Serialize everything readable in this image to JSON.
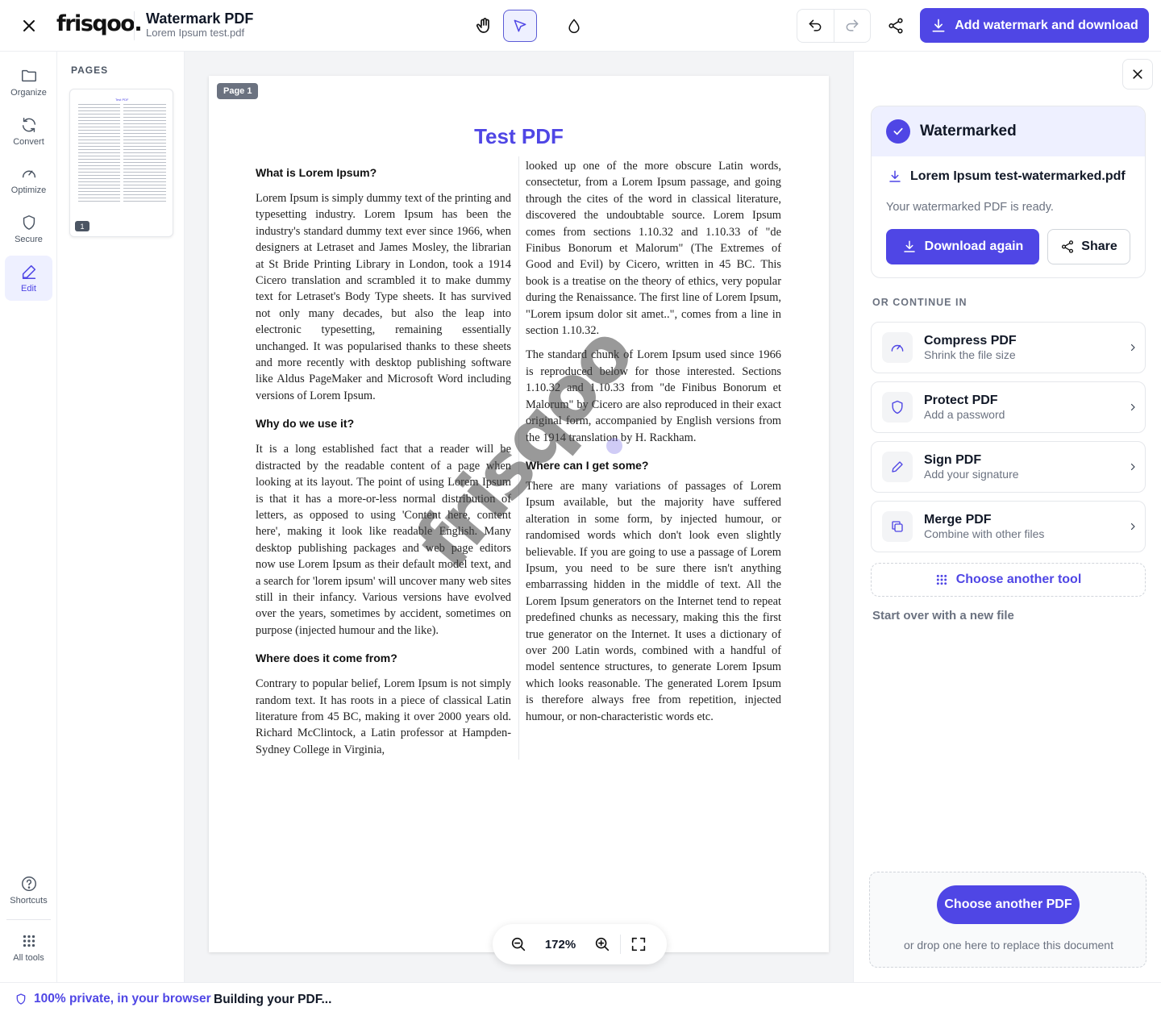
{
  "header": {
    "logo": "frisqoo.",
    "title": "Watermark PDF",
    "filename": "Lorem Ipsum test.pdf",
    "primary_label": "Add watermark and download"
  },
  "rail": {
    "items": [
      {
        "label": "Organize",
        "icon": "folder-icon"
      },
      {
        "label": "Convert",
        "icon": "refresh-icon"
      },
      {
        "label": "Optimize",
        "icon": "gauge-icon"
      },
      {
        "label": "Secure",
        "icon": "shield-icon"
      },
      {
        "label": "Edit",
        "icon": "pencil-icon",
        "active": true
      }
    ],
    "bottom": [
      {
        "label": "Shortcuts",
        "icon": "question-icon"
      },
      {
        "label": "All tools",
        "icon": "grid-icon"
      }
    ]
  },
  "pages_panel": {
    "title": "PAGES",
    "thumb_title": "Test PDF",
    "page_number": "1"
  },
  "document": {
    "page_tag": "Page 1",
    "title": "Test PDF",
    "watermark": "frisqoo",
    "left_column": [
      {
        "heading": "What is Lorem Ipsum?",
        "text": "Lorem Ipsum is simply dummy text of the printing and typesetting industry. Lorem Ipsum has been the industry's standard dummy text ever since 1966, when designers at Letraset and James Mosley, the librarian at St Bride Printing Library in London, took a 1914 Cicero translation and scrambled it to make dummy text for Letraset's Body Type sheets. It has survived not only many decades, but also the leap into electronic typesetting, remaining essentially unchanged. It was popularised thanks to these sheets and more recently with desktop publishing software like Aldus PageMaker and Microsoft Word including versions of Lorem Ipsum."
      },
      {
        "heading": "Why do we use it?",
        "text": "It is a long established fact that a reader will be distracted by the readable content of a page when looking at its layout. The point of using Lorem Ipsum is that it has a more-or-less normal distribution of letters, as opposed to using 'Content here, content here', making it look like readable English. Many desktop publishing packages and web page editors now use Lorem Ipsum as their default model text, and a search for 'lorem ipsum' will uncover many web sites still in their infancy. Various versions have evolved over the years, sometimes by accident, sometimes on purpose (injected humour and the like)."
      },
      {
        "heading": "Where does it come from?",
        "text": "Contrary to popular belief, Lorem Ipsum is not simply random text. It has roots in a piece of classical Latin literature from 45 BC, making it over 2000 years old. Richard McClintock, a Latin professor at Hampden-Sydney College in Virginia,"
      }
    ],
    "right_column": {
      "p1": "looked up one of the more obscure Latin words, consectetur, from a Lorem Ipsum passage, and going through the cites of the word in classical literature, discovered the undoubtable source. Lorem Ipsum comes from sections 1.10.32 and 1.10.33 of \"de Finibus Bonorum et Malorum\" (The Extremes of Good and Evil) by Cicero, written in 45 BC. This book is a treatise on the theory of ethics, very popular during the Renaissance. The first line of Lorem Ipsum, \"Lorem ipsum dolor sit amet..\", comes from a line in section 1.10.32.",
      "p2": "The standard chunk of Lorem Ipsum used since 1966 is reproduced below for those interested. Sections 1.10.32 and 1.10.33 from \"de Finibus Bonorum et Malorum\" by Cicero are also reproduced in their exact original form, accompanied by English versions from the 1914 translation by H. Rackham.",
      "heading": "Where can I get some?",
      "p3": "There are many variations of passages of Lorem Ipsum available, but the majority have suffered alteration in some form, by injected humour, or randomised words which don't look even slightly believable. If you are going to use a passage of Lorem Ipsum, you need to be sure there isn't anything embarrassing hidden in the middle of text. All the Lorem Ipsum generators on the Internet tend to repeat predefined chunks as necessary, making this the first true generator on the Internet. It uses a dictionary of over 200 Latin words, combined with a handful of model sentence structures, to generate Lorem Ipsum which looks reasonable. The generated Lorem Ipsum is therefore always free from repetition, injected humour, or non-characteristic words etc."
    }
  },
  "zoom": {
    "value": "172%"
  },
  "right_panel": {
    "done_title": "Watermarked",
    "output_file": "Lorem Ipsum test-watermarked.pdf",
    "ready_text": "Your watermarked PDF is ready.",
    "download_again": "Download again",
    "share": "Share",
    "or_continue": "OR CONTINUE IN",
    "tools": [
      {
        "name": "Compress PDF",
        "desc": "Shrink the file size",
        "icon": "gauge-icon"
      },
      {
        "name": "Protect PDF",
        "desc": "Add a password",
        "icon": "shield-icon"
      },
      {
        "name": "Sign PDF",
        "desc": "Add your signature",
        "icon": "pen-icon"
      },
      {
        "name": "Merge PDF",
        "desc": "Combine with other files",
        "icon": "copy-icon"
      }
    ],
    "choose_tool": "Choose another tool",
    "start_over": "Start over with a new file",
    "choose_pdf": "Choose another PDF",
    "drop_text": "or drop one here to replace this document"
  },
  "footer": {
    "privacy": "100% private, in your browser",
    "status": "Building your PDF..."
  },
  "colors": {
    "accent": "#4f46e5",
    "accent_soft": "#eef0ff"
  }
}
